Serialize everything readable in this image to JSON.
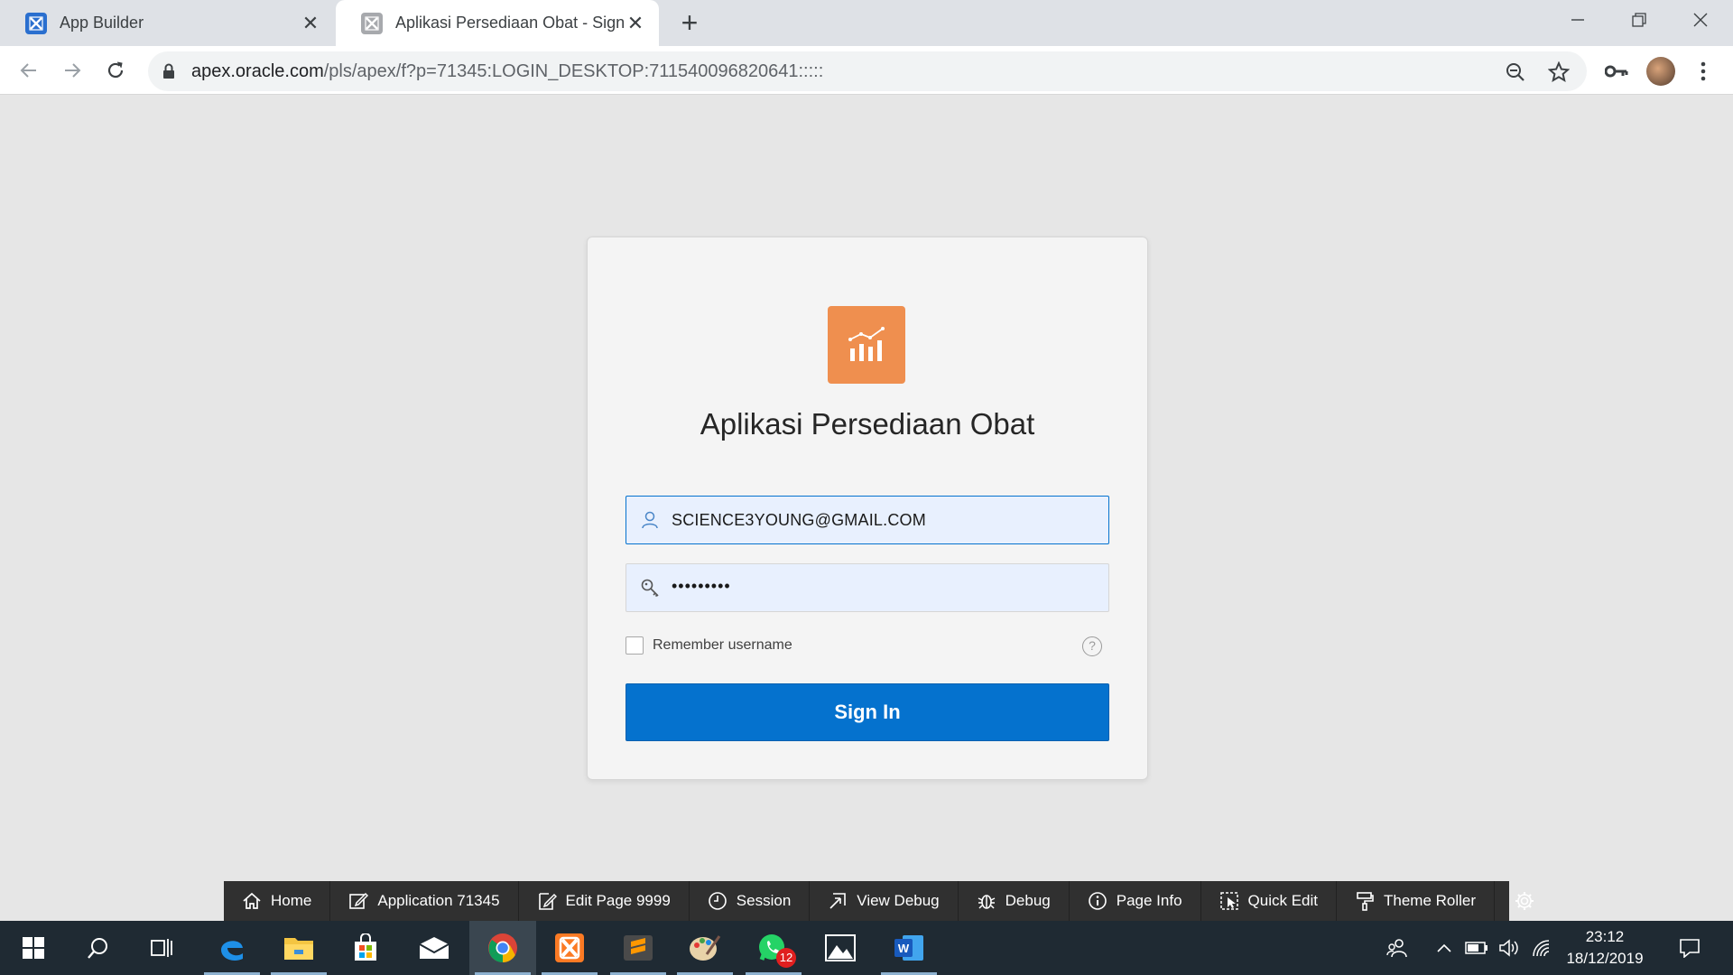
{
  "browser": {
    "tabs": [
      {
        "title": "App Builder",
        "active": false
      },
      {
        "title": "Aplikasi Persediaan Obat - Sign I",
        "active": true
      }
    ],
    "url_host": "apex.oracle.com",
    "url_path": "/pls/apex/f?p=71345:LOGIN_DESKTOP:711540096820641:::::"
  },
  "login": {
    "app_title": "Aplikasi Persediaan Obat",
    "username_value": "SCIENCE3YOUNG@GMAIL.COM",
    "password_masked": "•••••••••",
    "remember_label": "Remember username",
    "help_symbol": "?",
    "signin_label": "Sign In",
    "accent_color": "#0572ce",
    "logo_color": "#ef8f4f"
  },
  "dev_toolbar": {
    "items": [
      {
        "label": "Home",
        "icon": "home-icon"
      },
      {
        "label": "Application 71345",
        "icon": "edit-icon"
      },
      {
        "label": "Edit Page 9999",
        "icon": "edit-page-icon"
      },
      {
        "label": "Session",
        "icon": "clock-icon"
      },
      {
        "label": "View Debug",
        "icon": "view-debug-icon"
      },
      {
        "label": "Debug",
        "icon": "bug-icon"
      },
      {
        "label": "Page Info",
        "icon": "info-icon"
      },
      {
        "label": "Quick Edit",
        "icon": "quick-edit-icon"
      },
      {
        "label": "Theme Roller",
        "icon": "paint-roller-icon"
      },
      {
        "label": "",
        "icon": "gear-icon"
      }
    ]
  },
  "taskbar": {
    "whatsapp_badge": "12",
    "time": "23:12",
    "date": "18/12/2019"
  }
}
